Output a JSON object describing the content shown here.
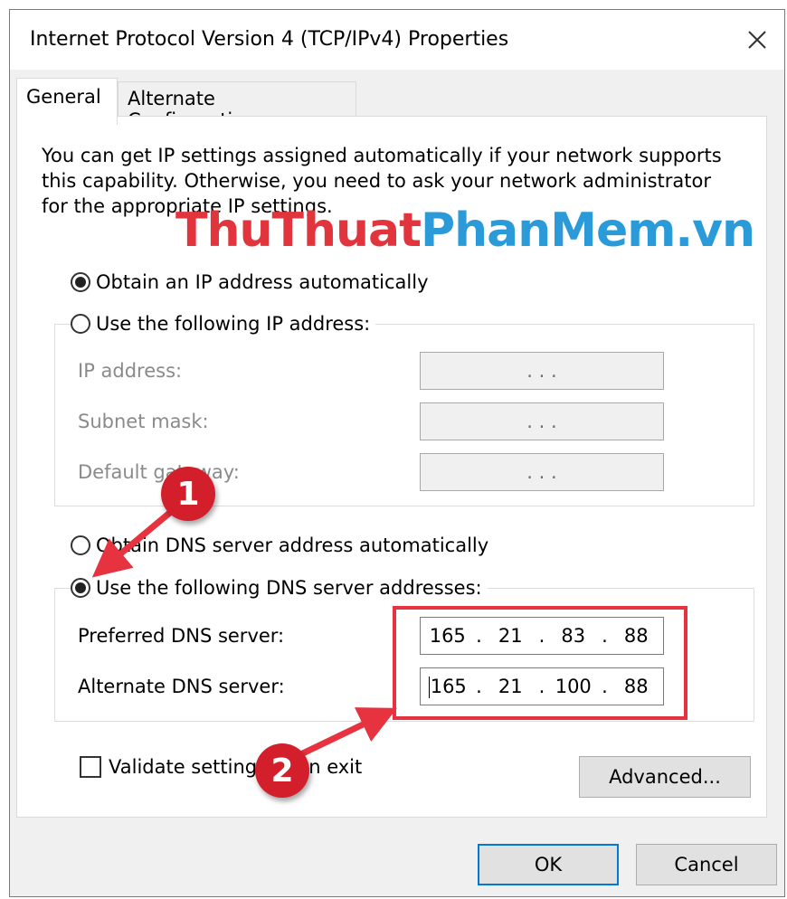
{
  "window": {
    "title": "Internet Protocol Version 4 (TCP/IPv4) Properties",
    "close_glyph": "✕"
  },
  "tabs": [
    {
      "label": "General",
      "selected": true
    },
    {
      "label": "Alternate Configuration",
      "selected": false
    }
  ],
  "intro_text": "You can get IP settings assigned automatically if your network supports this capability. Otherwise, you need to ask your network administrator for the appropriate IP settings.",
  "watermark": {
    "part1": "ThuThuat",
    "part2": "PhanMem.vn"
  },
  "ip_section": {
    "auto_label": "Obtain an IP address automatically",
    "auto_selected": true,
    "manual_label": "Use the following IP address:",
    "fields": [
      {
        "label": "IP address:",
        "value": ".    .    ."
      },
      {
        "label": "Subnet mask:",
        "value": ".    .    ."
      },
      {
        "label": "Default gateway:",
        "value": ".    .    ."
      }
    ]
  },
  "dns_section": {
    "auto_label": "Obtain DNS server address automatically",
    "manual_label": "Use the following DNS server addresses:",
    "manual_selected": true,
    "preferred": {
      "label": "Preferred DNS server:",
      "octets": [
        "165",
        "21",
        "83",
        "88"
      ]
    },
    "alternate": {
      "label": "Alternate DNS server:",
      "octets": [
        "165",
        "21",
        "100",
        "88"
      ]
    }
  },
  "validate_label": "Validate settings upon exit",
  "buttons": {
    "advanced": "Advanced...",
    "ok": "OK",
    "cancel": "Cancel"
  },
  "annotations": {
    "step1": "1",
    "step2": "2",
    "color": "#d21f2b"
  }
}
